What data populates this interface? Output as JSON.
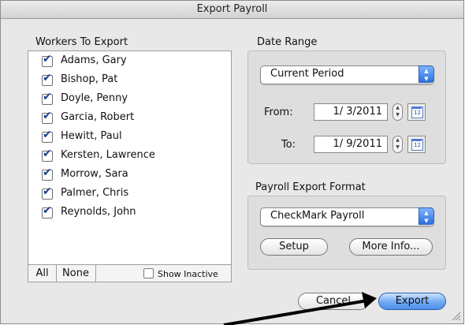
{
  "window": {
    "title": "Export Payroll"
  },
  "workers": {
    "label": "Workers To Export",
    "items": [
      {
        "name": "Adams, Gary",
        "checked": true
      },
      {
        "name": "Bishop, Pat",
        "checked": true
      },
      {
        "name": "Doyle, Penny",
        "checked": true
      },
      {
        "name": "Garcia, Robert",
        "checked": true
      },
      {
        "name": "Hewitt, Paul",
        "checked": true
      },
      {
        "name": "Kersten, Lawrence",
        "checked": true
      },
      {
        "name": "Morrow, Sara",
        "checked": true
      },
      {
        "name": "Palmer, Chris",
        "checked": true
      },
      {
        "name": "Reynolds, John",
        "checked": true
      }
    ],
    "all_label": "All",
    "none_label": "None",
    "show_inactive_label": "Show Inactive"
  },
  "date_range": {
    "label": "Date Range",
    "period": "Current Period",
    "from_label": "From:",
    "from_value": "1/ 3/2011",
    "to_label": "To:",
    "to_value": "1/ 9/2011",
    "calendar_day": "12"
  },
  "export_format": {
    "label": "Payroll Export Format",
    "value": "CheckMark Payroll",
    "setup_label": "Setup",
    "more_info_label": "More Info..."
  },
  "footer": {
    "cancel_label": "Cancel",
    "export_label": "Export"
  }
}
